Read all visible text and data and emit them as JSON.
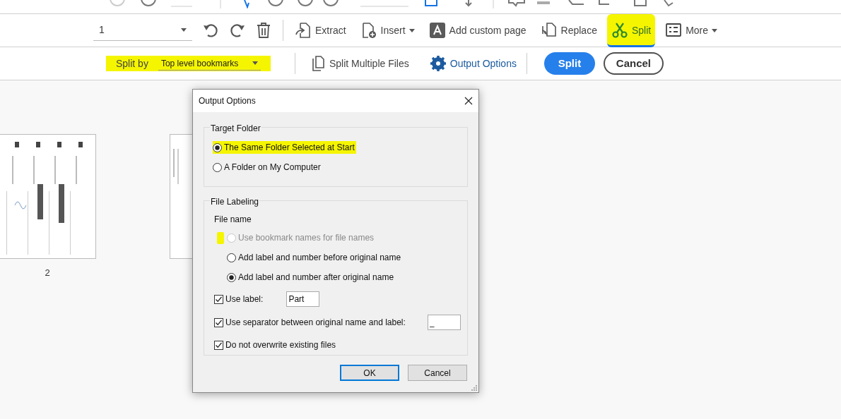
{
  "page_toolbar": {
    "page_field": {
      "value": "1"
    },
    "tools": [
      {
        "label": "Extract",
        "dropdown": false,
        "selected": false,
        "highlighted": false
      },
      {
        "label": "Insert",
        "dropdown": true,
        "selected": false,
        "highlighted": false
      },
      {
        "label": "Add custom page",
        "dropdown": false,
        "selected": false,
        "highlighted": false
      },
      {
        "label": "Replace",
        "dropdown": false,
        "selected": false,
        "highlighted": false
      },
      {
        "label": "Split",
        "dropdown": false,
        "selected": true,
        "highlighted": true
      },
      {
        "label": "More",
        "dropdown": true,
        "selected": false,
        "highlighted": false
      }
    ]
  },
  "split_bar": {
    "split_by": {
      "label": "Split by",
      "value": "Top level bookmarks",
      "highlighted": true
    },
    "split_multiple": "Split Multiple Files",
    "output_options": "Output Options",
    "split_button": "Split",
    "cancel_button": "Cancel"
  },
  "thumbnails": [
    {
      "kind": "picture",
      "label": "2"
    },
    {
      "kind": "picture"
    }
  ],
  "dialog": {
    "title": "Output Options",
    "target_folder": {
      "title": "Target Folder",
      "options": [
        {
          "label": "The Same Folder Selected at Start",
          "selected": true,
          "highlighted": true
        },
        {
          "label": "A Folder on My Computer",
          "selected": false,
          "highlighted": false
        }
      ]
    },
    "file_labeling": {
      "title": "File Labeling",
      "subtitle": "File name",
      "options": [
        {
          "label": "Use bookmark names for file names",
          "selected": false,
          "disabled": true,
          "marker": true
        },
        {
          "label": "Add label and number before original name",
          "selected": false,
          "disabled": false,
          "marker": false
        },
        {
          "label": "Add label and number after original name",
          "selected": true,
          "disabled": false,
          "marker": false
        }
      ],
      "checks": [
        {
          "label": "Use label:",
          "checked": true,
          "field": "Part",
          "kind": "label"
        },
        {
          "label": "Use separator between original name and label:",
          "checked": true,
          "field": "_",
          "kind": "separator"
        },
        {
          "label": "Do not overwrite existing files",
          "checked": true,
          "kind": "plain"
        }
      ]
    },
    "buttons": [
      {
        "label": "OK",
        "default": true
      },
      {
        "label": "Cancel",
        "default": false
      }
    ]
  }
}
